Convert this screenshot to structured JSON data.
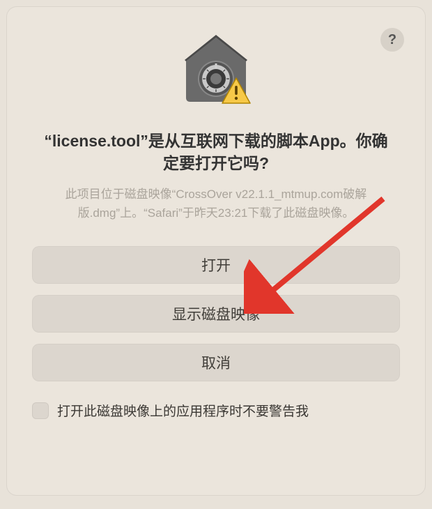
{
  "help": "?",
  "title": "“license.tool”是从互联网下载的脚本App。你确定要打开它吗?",
  "subtitle": "此项目位于磁盘映像“CrossOver v22.1.1_mtmup.com破解版.dmg”上。“Safari”于昨天23:21下载了此磁盘映像。",
  "buttons": {
    "open": "打开",
    "show": "显示磁盘映像",
    "cancel": "取消"
  },
  "checkbox_label": "打开此磁盘映像上的应用程序时不要警告我"
}
